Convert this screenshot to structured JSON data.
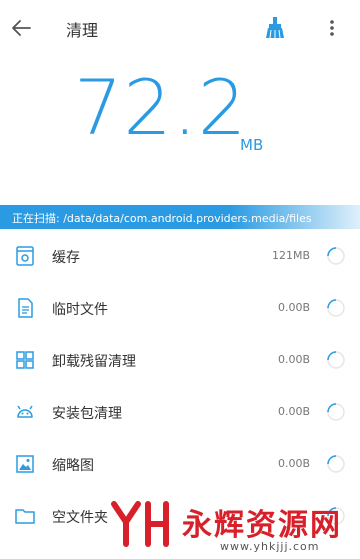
{
  "header": {
    "title": "清理"
  },
  "summary": {
    "size_value": "72.2",
    "size_unit": "MB"
  },
  "scan": {
    "status_text": "正在扫描: /data/data/com.android.providers.media/files"
  },
  "items": [
    {
      "label": "缓存",
      "size": "121MB",
      "icon": "gear-box-icon"
    },
    {
      "label": "临时文件",
      "size": "0.00B",
      "icon": "document-icon"
    },
    {
      "label": "卸载残留清理",
      "size": "0.00B",
      "icon": "grid-icon"
    },
    {
      "label": "安装包清理",
      "size": "0.00B",
      "icon": "android-icon"
    },
    {
      "label": "缩略图",
      "size": "0.00B",
      "icon": "image-icon"
    },
    {
      "label": "空文件夹",
      "size": "",
      "icon": "folder-icon"
    }
  ],
  "watermark": {
    "name": "永辉资源网",
    "url": "www.yhkjjj.com"
  },
  "colors": {
    "accent": "#2a9be2",
    "watermark": "#d8202a"
  }
}
